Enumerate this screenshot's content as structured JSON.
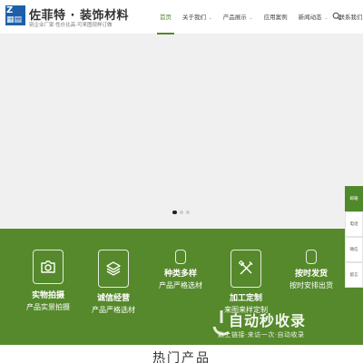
{
  "header": {
    "logo_text": "Z",
    "brand": "佐菲特 · 装饰材料",
    "tagline": "别企业厂家·性价比高·可来图现样订做"
  },
  "nav": {
    "items": [
      {
        "label": "首页",
        "caret": false
      },
      {
        "label": "关于我们",
        "caret": true
      },
      {
        "label": "产品展示",
        "caret": true
      },
      {
        "label": "应用案例",
        "caret": false
      },
      {
        "label": "新闻动态",
        "caret": true
      },
      {
        "label": "联系我们",
        "caret": false
      }
    ],
    "search_icon": "search-icon"
  },
  "hero": {
    "slide_count": 3,
    "active_slide": 1
  },
  "features": [
    {
      "title": "实物拍摄",
      "subtitle": "产品实景拍摄",
      "icon": "camera-icon"
    },
    {
      "title": "诚信经营",
      "subtitle": "产品严格选材",
      "icon": "layers-icon"
    },
    {
      "title": "种类多样",
      "subtitle": "产品严格选材",
      "icon": "phone-icon"
    },
    {
      "title": "加工定制",
      "subtitle": "来图来样定制",
      "icon": "tools-icon"
    },
    {
      "title": "按时发货",
      "subtitle": "按时安排出货",
      "icon": "phone-icon"
    }
  ],
  "sidebar": {
    "items": [
      "邮箱",
      "电话",
      "微信",
      "留言"
    ]
  },
  "watermark": {
    "text": "自动秒收录",
    "sub": "数上链接·来访一次·自动收录"
  },
  "section": {
    "title": "热门产品"
  },
  "colors": {
    "brand_green": "#55892b",
    "logo_blue": "#1e5faa"
  }
}
